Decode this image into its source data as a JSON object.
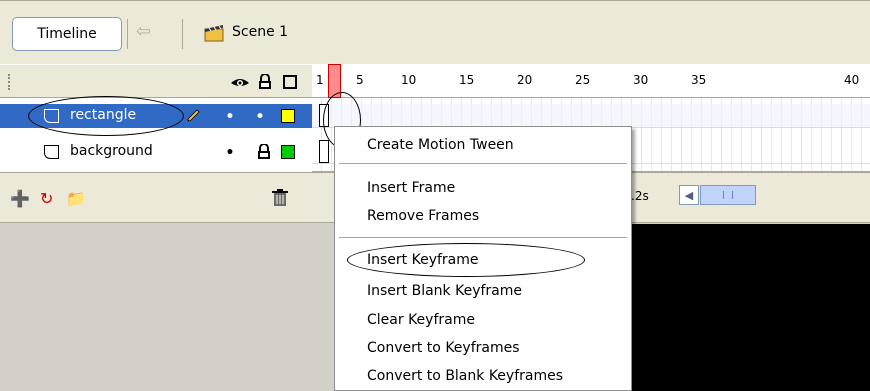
{
  "toolbar": {
    "timeline_label": "Timeline",
    "back_icon": "back-arrow-icon",
    "scene_label": "Scene 1"
  },
  "ruler": {
    "frame_numbers": [
      "1",
      "5",
      "10",
      "15",
      "20",
      "25",
      "30",
      "35",
      "40"
    ],
    "current_frame": 1
  },
  "layers": [
    {
      "name": "rectangle",
      "selected": true,
      "color": "#ffff00"
    },
    {
      "name": "background",
      "selected": false,
      "color": "#00cc00"
    }
  ],
  "status": {
    "time": ".2s"
  },
  "context_menu": {
    "items": [
      "Create Motion Tween",
      "Insert Frame",
      "Remove Frames",
      "Insert Keyframe",
      "Insert Blank Keyframe",
      "Clear Keyframe",
      "Convert to Keyframes",
      "Convert to Blank Keyframes"
    ]
  },
  "colors": {
    "selection": "#316ac5",
    "panel": "#ece9d8",
    "playhead": "#ff8b8b"
  }
}
